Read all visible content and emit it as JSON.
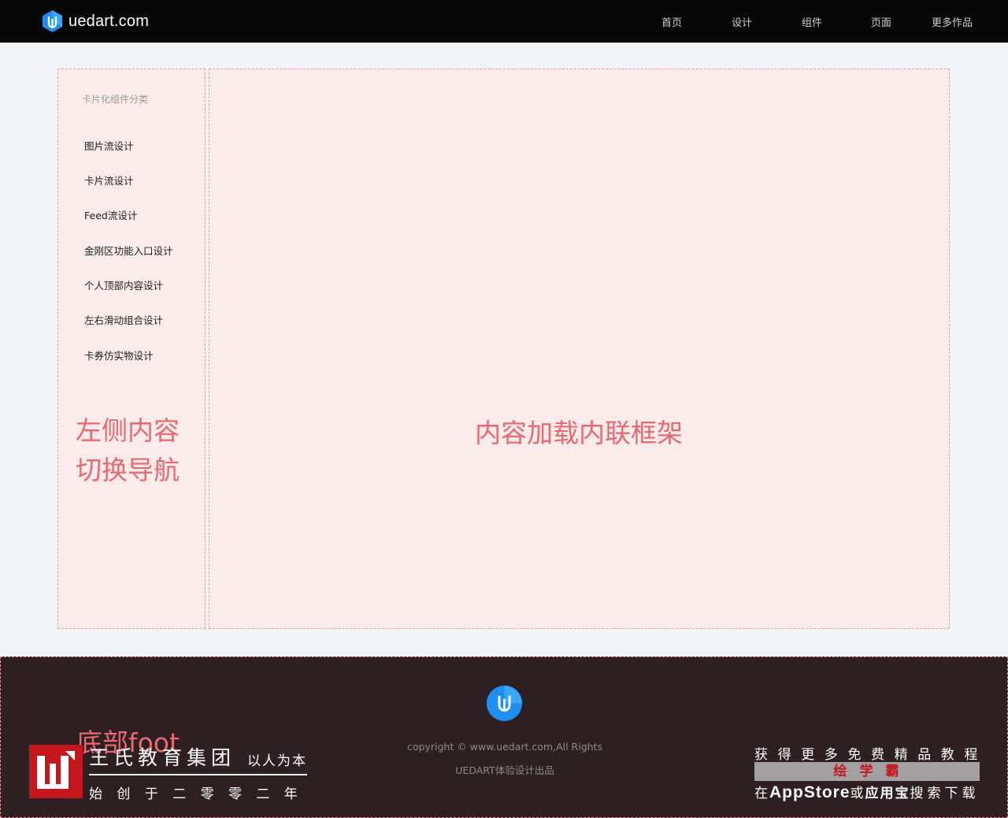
{
  "header": {
    "site_name": "uedart.com",
    "logo_icon": "uedart-logo-icon",
    "nav": [
      {
        "label": "首页"
      },
      {
        "label": "设计"
      },
      {
        "label": "组件"
      },
      {
        "label": "页面"
      },
      {
        "label": "更多作品"
      }
    ]
  },
  "sidebar": {
    "title": "卡片化组件分类",
    "items": [
      {
        "label": "图片流设计"
      },
      {
        "label": "卡片流设计"
      },
      {
        "label": "Feed流设计"
      },
      {
        "label": "金刚区功能入口设计"
      },
      {
        "label": "个人顶部内容设计"
      },
      {
        "label": "左右滑动组合设计"
      },
      {
        "label": "卡券仿实物设计"
      }
    ],
    "annotation_line1": "左侧内容",
    "annotation_line2": "切换导航"
  },
  "main": {
    "annotation": "内容加载内联框架"
  },
  "footer": {
    "annotation": "底部foot",
    "copyright": "copyright © www.uedart.com,All Rights",
    "credit": "UEDART体验设计出品",
    "brand": {
      "name": "王氏教育集团",
      "slogan": "以人为本",
      "founded": "始创于二零零二年"
    },
    "promo": {
      "line1": "获得更多免费精品教程",
      "app_name": "绘学霸",
      "line3_prefix": "在",
      "line3_store": "AppStore",
      "line3_or": "或",
      "line3_market": "应用宝",
      "line3_suffix": "搜索下载"
    }
  },
  "colors": {
    "header_bg": "#070707",
    "accent_blue": "#1e8ef0",
    "annotation_red": "#e86a70",
    "dashed_border": "#ef9a9f",
    "panel_bg": "#fcebeb",
    "footer_bg": "#2e1f22",
    "brand_red": "#c5161d"
  }
}
